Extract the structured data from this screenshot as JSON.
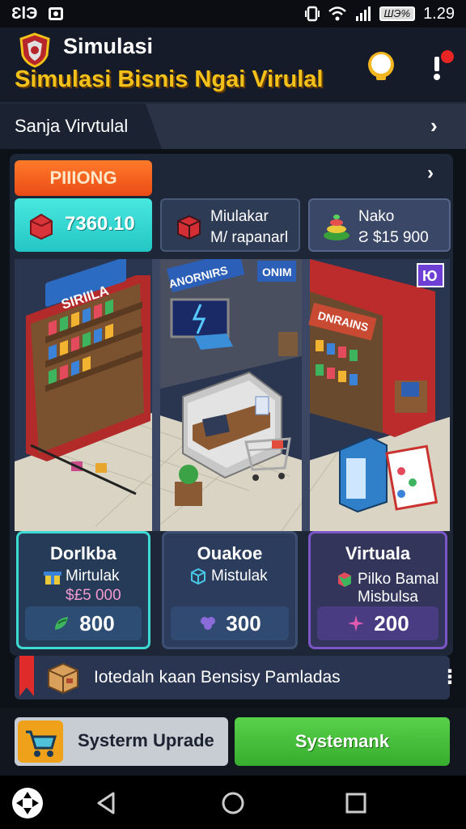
{
  "status_bar": {
    "left_text": "ƐlЭ",
    "battery_text": "ШЭ%",
    "time": "1.29"
  },
  "header": {
    "app_name": "Simulasi",
    "app_title": "Simulasi Bisnis Ngai Virulal",
    "crest_icon": "shield-crest-icon",
    "hint_icon": "lightbulb-icon",
    "alert_icon": "alert-icon"
  },
  "section": {
    "label": "Sanja Virvtulal",
    "arrow": "›"
  },
  "panel": {
    "badge_label": "PIIIONG",
    "arrow": "›"
  },
  "stats": [
    {
      "icon": "red-box-icon",
      "value": "7360.10"
    },
    {
      "icon": "red-cube-icon",
      "line1": "Miulakar",
      "line2": "M/ rapanarl"
    },
    {
      "icon": "stack-pyramid-icon",
      "line1": "Nako",
      "line2": "Ƨ $15 900"
    }
  ],
  "scene": {
    "shop1_sign": "SIRIILA",
    "shop2_sign": "ANORNIRS",
    "shop2_sign2": "ONIM",
    "shop3_sign": "DNRAINS",
    "corner_badge": "Ю"
  },
  "cards": [
    {
      "name": "Dorlkba",
      "sub": "Mirtulak",
      "price": "$£5 000",
      "buy_value": "800",
      "accent": "#3ddad4"
    },
    {
      "name": "Ouakoe",
      "sub": "Mistulak",
      "buy_value": "300",
      "accent": "#3d4f72"
    },
    {
      "name": "Virtuala",
      "sub_line1": "Pilko Bamal",
      "sub_line2": "Misbulsa",
      "buy_value": "200",
      "accent": "#7c56c7"
    }
  ],
  "notice": {
    "text": "Iotedaln kaan Bensisy Pamladas",
    "more": "⋮"
  },
  "actions": {
    "upgrade_label": "Systerm Uprade",
    "system_label": "Systemank"
  },
  "nav": {
    "home_icon": "dpad-icon",
    "back_icon": "back-icon",
    "circle_icon": "home-circle-icon",
    "square_icon": "recents-icon"
  }
}
